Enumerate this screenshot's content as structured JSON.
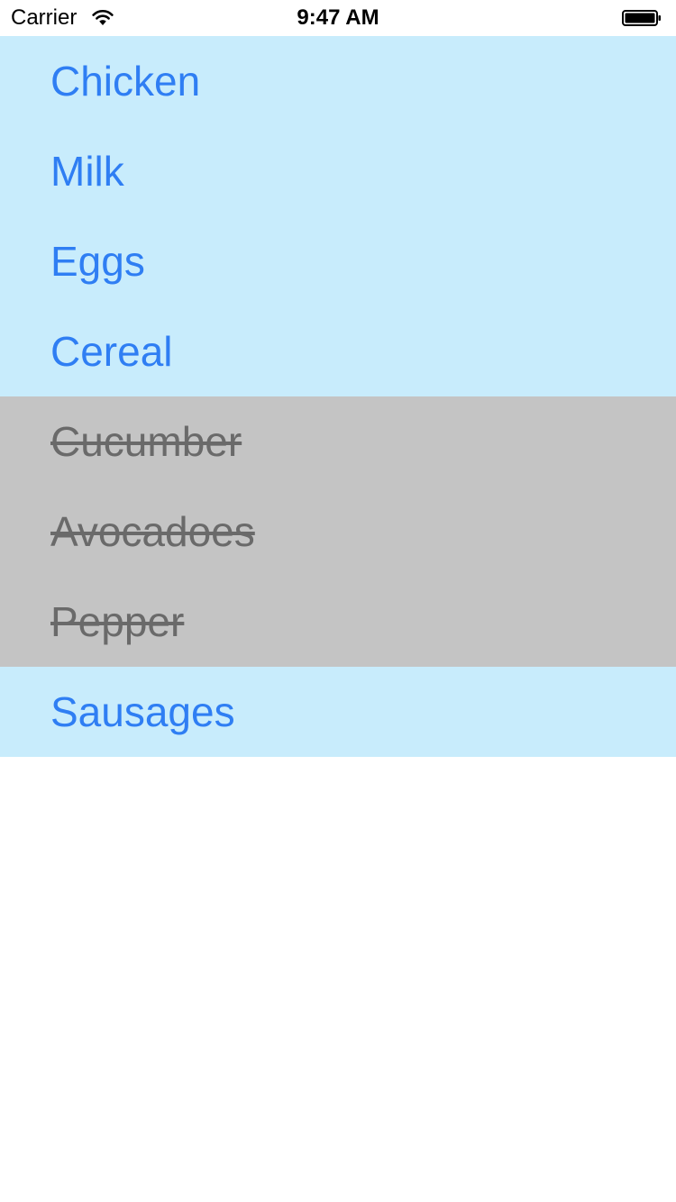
{
  "status_bar": {
    "carrier": "Carrier",
    "time": "9:47 AM",
    "wifi_icon": "wifi-icon",
    "battery_icon": "battery-icon"
  },
  "colors": {
    "pending_row_bg": "#c8ecfc",
    "pending_text": "#2f7ef3",
    "done_row_bg": "#c4c4c4",
    "done_text": "#6a6a6a"
  },
  "items": [
    {
      "label": "Chicken",
      "done": false
    },
    {
      "label": "Milk",
      "done": false
    },
    {
      "label": "Eggs",
      "done": false
    },
    {
      "label": "Cereal",
      "done": false
    },
    {
      "label": "Cucumber",
      "done": true
    },
    {
      "label": "Avocadoes",
      "done": true
    },
    {
      "label": "Pepper",
      "done": true
    },
    {
      "label": "Sausages",
      "done": false
    }
  ]
}
